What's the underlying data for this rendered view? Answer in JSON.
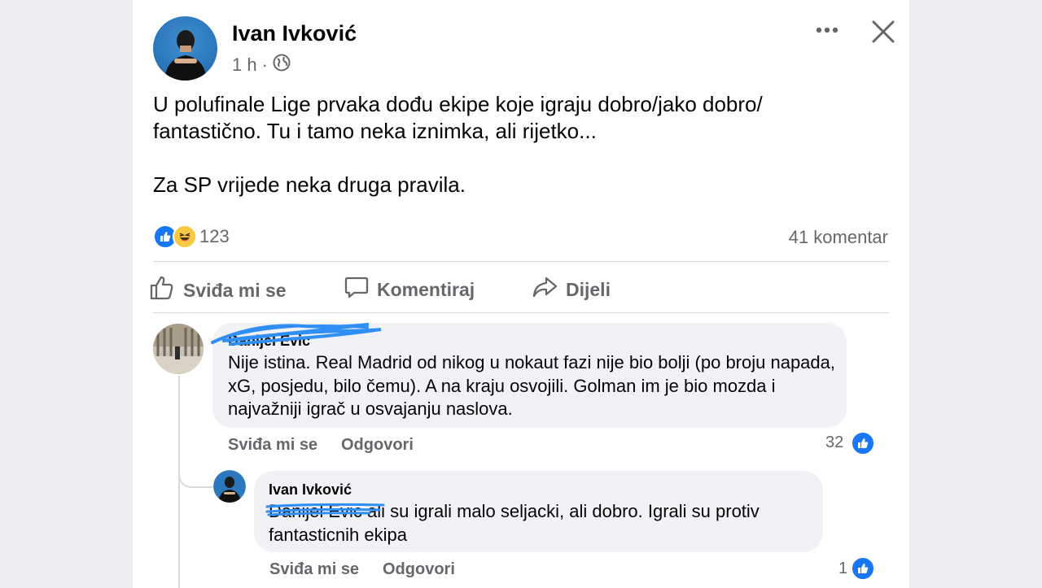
{
  "post": {
    "author": "Ivan Ivković",
    "time": "1 h",
    "dot": "·",
    "paragraphs": [
      "U polufinale Lige prvaka dođu ekipe koje igraju dobro/jako dobro/ fantastično. Tu i tamo neka iznimka, ali rijetko...",
      "Za SP vrijede neka druga pravila."
    ],
    "reaction_count": "123",
    "comment_count": "41 komentar"
  },
  "actions": {
    "like": "Sviđa mi se",
    "comment": "Komentiraj",
    "share": "Dijeli"
  },
  "comments": [
    {
      "author": "Danijel Evic",
      "text": "Nije istina. Real Madrid od nikog u nokaut fazi nije bio bolji (po broju napada, xG, posjedu, bilo čemu). A na kraju osvojili. Golman im je bio mozda i najvažniji igrač u osvajanju naslova.",
      "like_label": "Sviđa mi se",
      "reply_label": "Odgovori",
      "likes": "32"
    }
  ],
  "reply": {
    "author": "Ivan Ivković",
    "mention": "Danijel Evic",
    "text": " ali su igrali malo seljacki, ali dobro. Igrali su protiv fantasticnih ekipa",
    "like_label": "Sviđa mi se",
    "reply_label": "Odgovori",
    "likes": "1"
  },
  "icons": {
    "more": "more-horizontal-icon",
    "close": "close-icon",
    "privacy": "globe-icon",
    "like": "thumbs-up-icon",
    "comment": "speech-bubble-icon",
    "share": "share-arrow-icon"
  },
  "colors": {
    "like_blue": "#1877f2",
    "secondary_text": "#65676b",
    "bubble_bg": "#f0f2f5",
    "scribble_blue": "#2f8ff5"
  }
}
